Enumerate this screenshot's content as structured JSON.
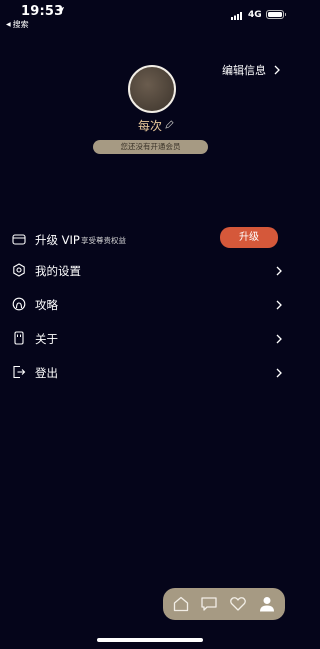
{
  "status_bar": {
    "time": "19:53",
    "back_app_label": "搜索",
    "network": "4G"
  },
  "profile": {
    "edit_info_label": "编辑信息",
    "nickname": "每次",
    "member_status": "您还没有开通会员"
  },
  "menu": {
    "vip": {
      "label": "升级 VIP",
      "sub": "享受尊贵权益",
      "button": "升级",
      "icon": "card-icon"
    },
    "settings": {
      "label": "我的设置",
      "icon": "gear-icon"
    },
    "guide": {
      "label": "攻略",
      "icon": "guide-icon"
    },
    "about": {
      "label": "关于",
      "icon": "phone-icon"
    },
    "logout": {
      "label": "登出",
      "icon": "logout-icon"
    }
  },
  "tab_bar": {
    "tabs": [
      "home-icon",
      "chat-icon",
      "heart-icon",
      "profile-icon"
    ],
    "active": "profile-icon"
  },
  "colors": {
    "background": "#05051a",
    "accent_gold": "#e9c99a",
    "badge": "#a69a83",
    "upgrade_button": "#d5583a"
  }
}
